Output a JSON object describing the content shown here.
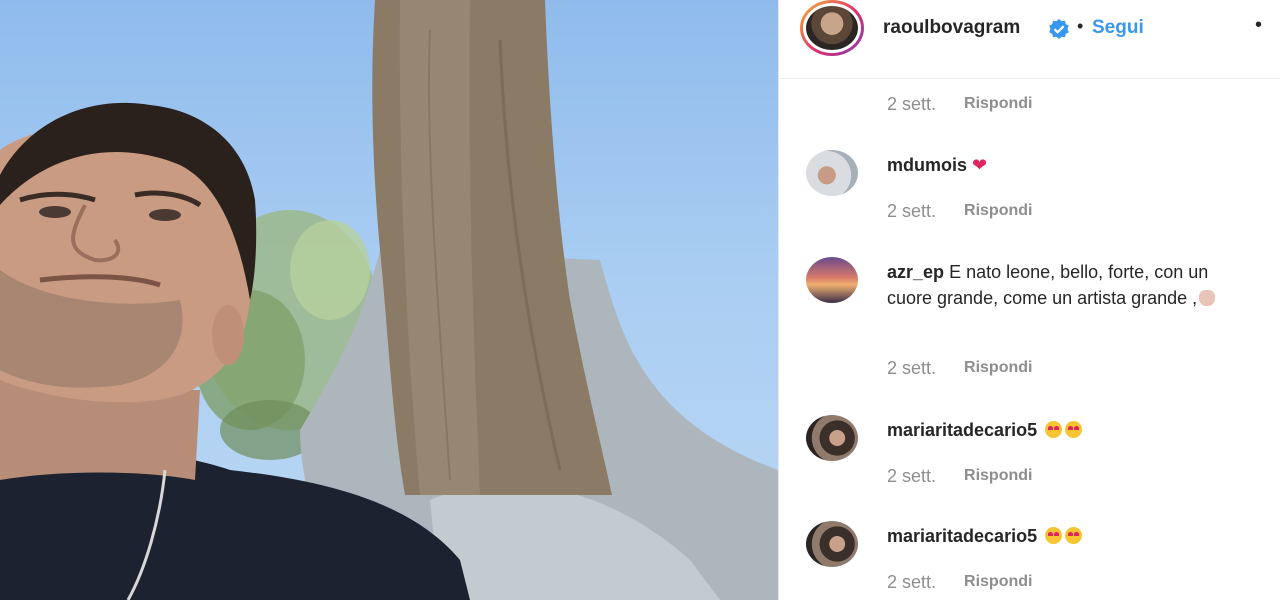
{
  "post": {
    "username": "raoulbovagram",
    "verified": true,
    "separator": "•",
    "follow_label": "Segui",
    "more_label": "•"
  },
  "top_meta": {
    "time": "2 sett.",
    "reply": "Rispondi"
  },
  "comments": [
    {
      "user": "mdumois",
      "text": "",
      "extra": "heart-icon",
      "time": "2 sett.",
      "reply": "Rispondi"
    },
    {
      "user": "azr_ep",
      "text": "E nato leone, bello, forte, con un cuore grande, come un artista grande ,",
      "extra": "clapping-hands-icon",
      "time": "2 sett.",
      "reply": "Rispondi"
    },
    {
      "user": "mariaritadecario5",
      "text": "",
      "extra": "heart-eyes-emoji-icon",
      "time": "2 sett.",
      "reply": "Rispondi"
    },
    {
      "user": "mariaritadecario5",
      "text": "",
      "extra": "heart-eyes-emoji-icon",
      "time": "2 sett.",
      "reply": "Rispondi"
    }
  ],
  "colors": {
    "accent": "#3897f0",
    "heart": "#e0245e",
    "text": "#262626",
    "muted": "#8e8e8e"
  }
}
